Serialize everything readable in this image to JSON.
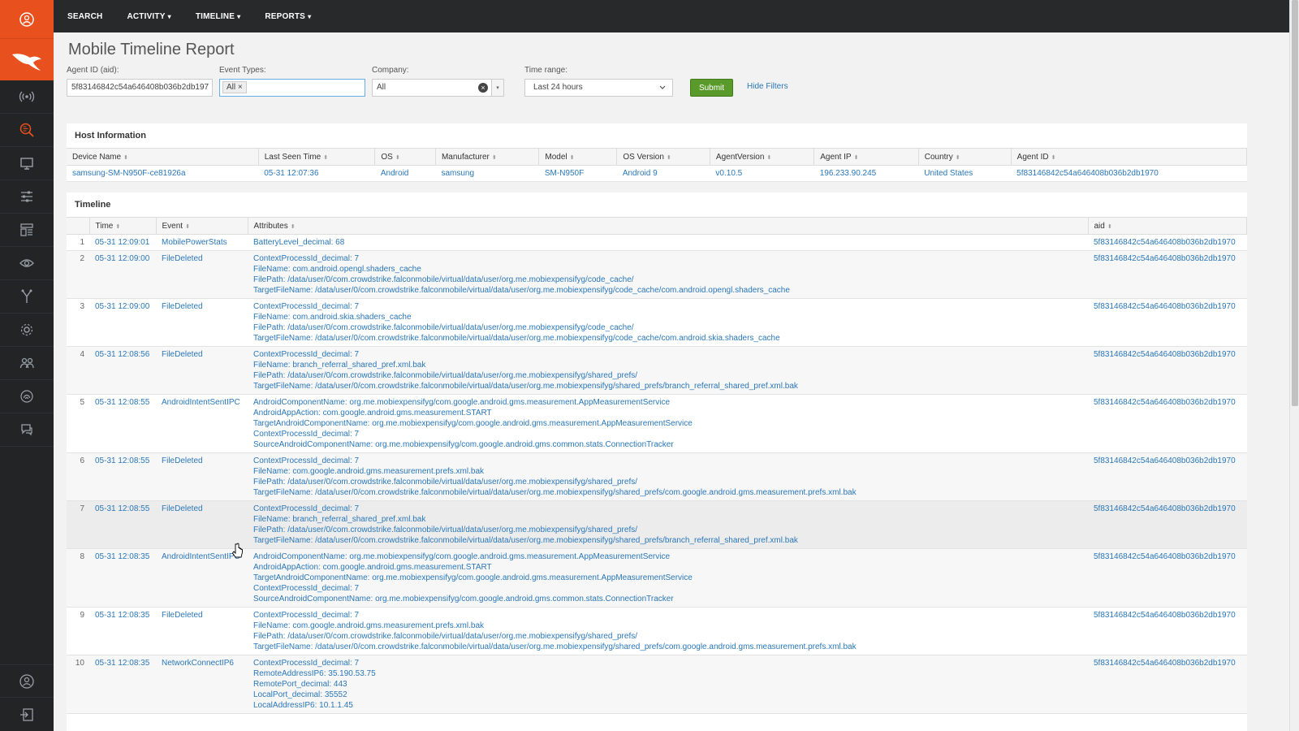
{
  "nav": {
    "items": [
      {
        "label": "SEARCH",
        "caret": ""
      },
      {
        "label": "ACTIVITY",
        "caret": "▾"
      },
      {
        "label": "TIMELINE",
        "caret": "▾"
      },
      {
        "label": "REPORTS",
        "caret": "▾"
      }
    ]
  },
  "page": {
    "title": "Mobile Timeline Report"
  },
  "filters": {
    "agent_id_label": "Agent ID (aid):",
    "agent_id_value": "5f83146842c54a646408b036b2db197",
    "event_types_label": "Event Types:",
    "event_types_tag": "All",
    "event_types_tag_remove": "×",
    "company_label": "Company:",
    "company_value": "All",
    "company_clear": "×",
    "company_arrow": "▾",
    "time_range_label": "Time range:",
    "time_range_value": "Last 24 hours",
    "submit_label": "Submit",
    "hide_filters_label": "Hide Filters"
  },
  "host": {
    "title": "Host Information",
    "columns": [
      "Device Name",
      "Last Seen Time",
      "OS",
      "Manufacturer",
      "Model",
      "OS Version",
      "AgentVersion",
      "Agent IP",
      "Country",
      "Agent ID"
    ],
    "row": [
      "samsung-SM-N950F-ce81926a",
      "05-31 12:07:36",
      "Android",
      "samsung",
      "SM-N950F",
      "Android 9",
      "v0.10.5",
      "196.233.90.245",
      "United States",
      "5f83146842c54a646408b036b2db1970"
    ]
  },
  "timeline": {
    "title": "Timeline",
    "columns": [
      "Time",
      "Event",
      "Attributes",
      "aid"
    ],
    "sort_glyph": "⬍",
    "rows": [
      {
        "n": "1",
        "time": "05-31 12:09:01",
        "event": "MobilePowerStats",
        "attrs": [
          "BatteryLevel_decimal: 68"
        ],
        "aid": "5f83146842c54a646408b036b2db1970"
      },
      {
        "n": "2",
        "time": "05-31 12:09:00",
        "event": "FileDeleted",
        "attrs": [
          "ContextProcessId_decimal: 7",
          "FileName: com.android.opengl.shaders_cache",
          "FilePath: /data/user/0/com.crowdstrike.falconmobile/virtual/data/user/org.me.mobiexpensifyg/code_cache/",
          "TargetFileName: /data/user/0/com.crowdstrike.falconmobile/virtual/data/user/org.me.mobiexpensifyg/code_cache/com.android.opengl.shaders_cache"
        ],
        "aid": "5f83146842c54a646408b036b2db1970"
      },
      {
        "n": "3",
        "time": "05-31 12:09:00",
        "event": "FileDeleted",
        "attrs": [
          "ContextProcessId_decimal: 7",
          "FileName: com.android.skia.shaders_cache",
          "FilePath: /data/user/0/com.crowdstrike.falconmobile/virtual/data/user/org.me.mobiexpensifyg/code_cache/",
          "TargetFileName: /data/user/0/com.crowdstrike.falconmobile/virtual/data/user/org.me.mobiexpensifyg/code_cache/com.android.skia.shaders_cache"
        ],
        "aid": "5f83146842c54a646408b036b2db1970"
      },
      {
        "n": "4",
        "time": "05-31 12:08:56",
        "event": "FileDeleted",
        "attrs": [
          "ContextProcessId_decimal: 7",
          "FileName: branch_referral_shared_pref.xml.bak",
          "FilePath: /data/user/0/com.crowdstrike.falconmobile/virtual/data/user/org.me.mobiexpensifyg/shared_prefs/",
          "TargetFileName: /data/user/0/com.crowdstrike.falconmobile/virtual/data/user/org.me.mobiexpensifyg/shared_prefs/branch_referral_shared_pref.xml.bak"
        ],
        "aid": "5f83146842c54a646408b036b2db1970"
      },
      {
        "n": "5",
        "time": "05-31 12:08:55",
        "event": "AndroidIntentSentIPC",
        "attrs": [
          "AndroidComponentName: org.me.mobiexpensifyg/com.google.android.gms.measurement.AppMeasurementService",
          "AndroidAppAction: com.google.android.gms.measurement.START",
          "TargetAndroidComponentName: org.me.mobiexpensifyg/com.google.android.gms.measurement.AppMeasurementService",
          "ContextProcessId_decimal: 7",
          "SourceAndroidComponentName: org.me.mobiexpensifyg/com.google.android.gms.common.stats.ConnectionTracker"
        ],
        "aid": "5f83146842c54a646408b036b2db1970"
      },
      {
        "n": "6",
        "time": "05-31 12:08:55",
        "event": "FileDeleted",
        "attrs": [
          "ContextProcessId_decimal: 7",
          "FileName: com.google.android.gms.measurement.prefs.xml.bak",
          "FilePath: /data/user/0/com.crowdstrike.falconmobile/virtual/data/user/org.me.mobiexpensifyg/shared_prefs/",
          "TargetFileName: /data/user/0/com.crowdstrike.falconmobile/virtual/data/user/org.me.mobiexpensifyg/shared_prefs/com.google.android.gms.measurement.prefs.xml.bak"
        ],
        "aid": "5f83146842c54a646408b036b2db1970"
      },
      {
        "n": "7",
        "time": "05-31 12:08:55",
        "event": "FileDeleted",
        "attrs": [
          "ContextProcessId_decimal: 7",
          "FileName: branch_referral_shared_pref.xml.bak",
          "FilePath: /data/user/0/com.crowdstrike.falconmobile/virtual/data/user/org.me.mobiexpensifyg/shared_prefs/",
          "TargetFileName: /data/user/0/com.crowdstrike.falconmobile/virtual/data/user/org.me.mobiexpensifyg/shared_prefs/branch_referral_shared_pref.xml.bak"
        ],
        "aid": "5f83146842c54a646408b036b2db1970"
      },
      {
        "n": "8",
        "time": "05-31 12:08:35",
        "event": "AndroidIntentSentIPC",
        "attrs": [
          "AndroidComponentName: org.me.mobiexpensifyg/com.google.android.gms.measurement.AppMeasurementService",
          "AndroidAppAction: com.google.android.gms.measurement.START",
          "TargetAndroidComponentName: org.me.mobiexpensifyg/com.google.android.gms.measurement.AppMeasurementService",
          "ContextProcessId_decimal: 7",
          "SourceAndroidComponentName: org.me.mobiexpensifyg/com.google.android.gms.common.stats.ConnectionTracker"
        ],
        "aid": "5f83146842c54a646408b036b2db1970"
      },
      {
        "n": "9",
        "time": "05-31 12:08:35",
        "event": "FileDeleted",
        "attrs": [
          "ContextProcessId_decimal: 7",
          "FileName: com.google.android.gms.measurement.prefs.xml.bak",
          "FilePath: /data/user/0/com.crowdstrike.falconmobile/virtual/data/user/org.me.mobiexpensifyg/shared_prefs/",
          "TargetFileName: /data/user/0/com.crowdstrike.falconmobile/virtual/data/user/org.me.mobiexpensifyg/shared_prefs/com.google.android.gms.measurement.prefs.xml.bak"
        ],
        "aid": "5f83146842c54a646408b036b2db1970"
      },
      {
        "n": "10",
        "time": "05-31 12:08:35",
        "event": "NetworkConnectIP6",
        "attrs": [
          "ContextProcessId_decimal: 7",
          "RemoteAddressIP6: 35.190.53.75",
          "RemotePort_decimal: 443",
          "LocalPort_decimal: 35552",
          "LocalAddressIP6: 10.1.1.45"
        ],
        "aid": "5f83146842c54a646408b036b2db1970"
      }
    ]
  },
  "sidebar": {
    "icons": [
      "user-circle-icon",
      "falcon-logo-icon",
      "broadcast-icon",
      "search-activity-icon",
      "monitor-icon",
      "sliders-icon",
      "dashboard-icon",
      "eye-icon",
      "fork-icon",
      "gear-icon",
      "users-icon",
      "fingerprint-icon",
      "chat-icon"
    ],
    "bottom_icons": [
      "profile-icon",
      "logout-icon"
    ]
  },
  "colors": {
    "accent": "#e8501e",
    "link": "#2a77b8",
    "submit": "#5a9a2a",
    "nav_bg": "#28292b",
    "sidebar_bg": "#222426"
  }
}
